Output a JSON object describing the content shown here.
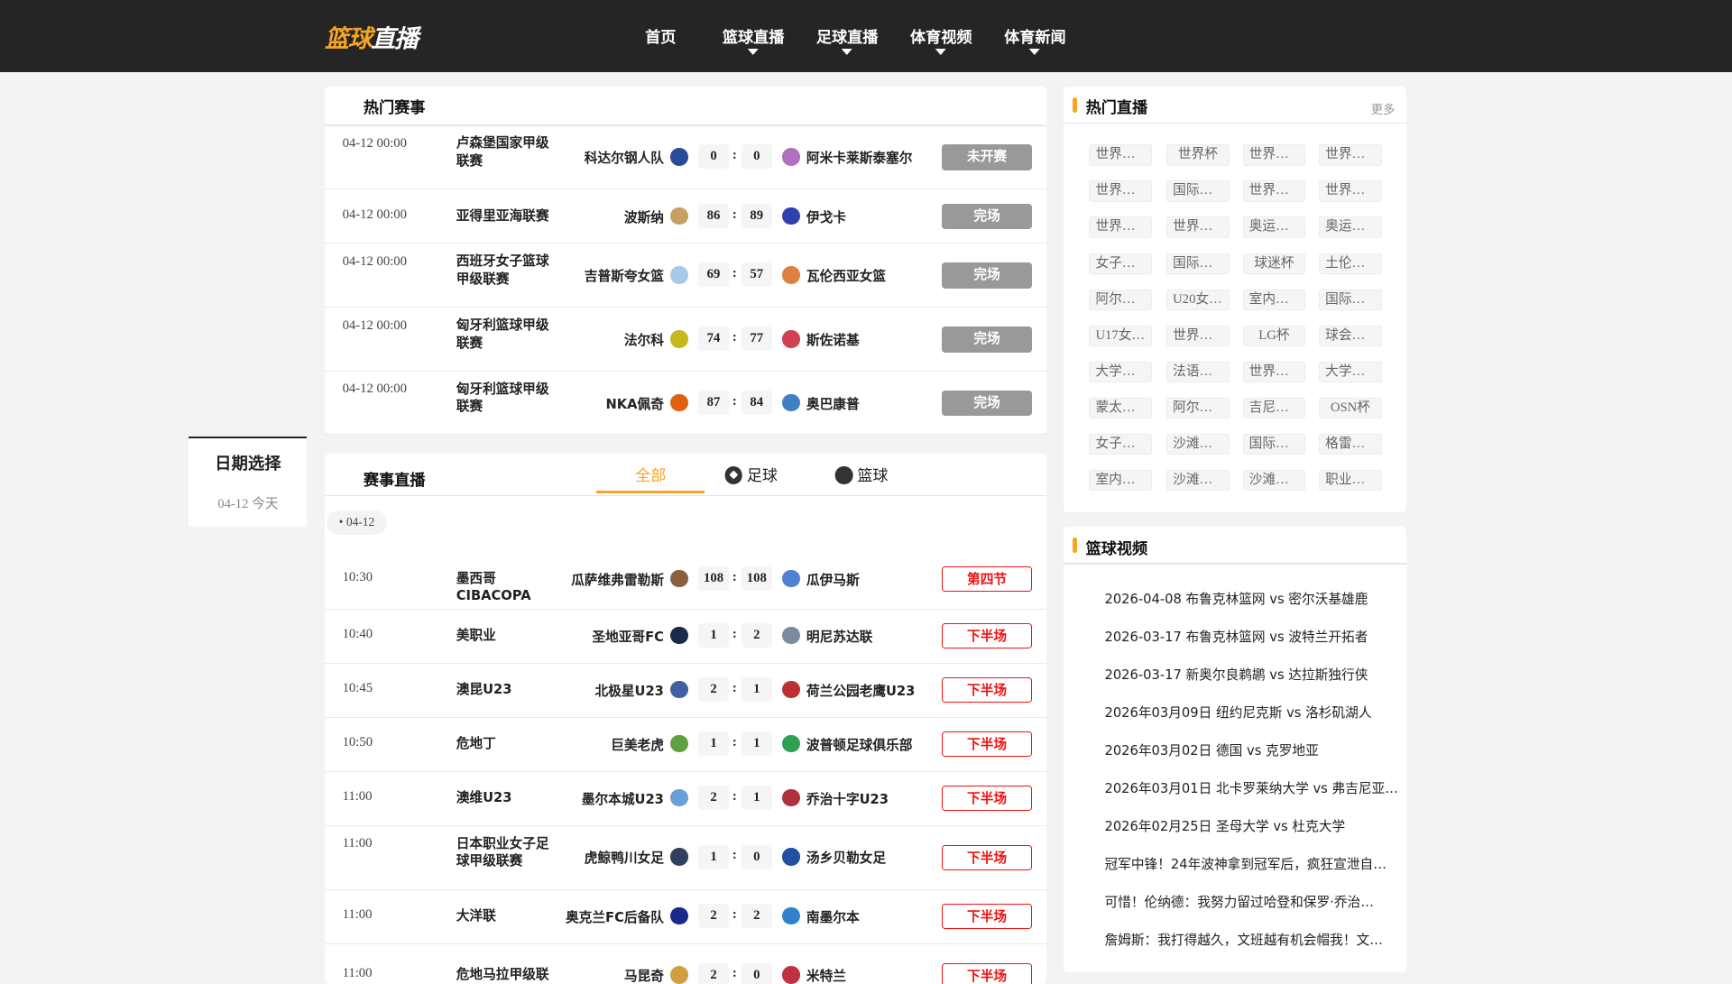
{
  "header": {
    "logo_part1": "篮球",
    "logo_part2": "直播",
    "nav": [
      {
        "label": "首页",
        "dropdown": false
      },
      {
        "label": "篮球直播",
        "dropdown": true
      },
      {
        "label": "足球直播",
        "dropdown": true
      },
      {
        "label": "体育视频",
        "dropdown": true
      },
      {
        "label": "体育新闻",
        "dropdown": true
      }
    ]
  },
  "date_picker": {
    "title": "日期选择",
    "value": "04-12 今天"
  },
  "hot_matches": {
    "title": "热门赛事",
    "rows": [
      {
        "time": "04-12 00:00",
        "league": "卢森堡国家甲级联赛",
        "home": "科达尔钢人队",
        "home_color": "#2a4a9a",
        "hs": "0",
        "as": "0",
        "away": "阿米卡莱斯泰塞尔",
        "away_color": "#b070c0",
        "status": "未开赛"
      },
      {
        "time": "04-12 00:00",
        "league": "亚得里亚海联赛",
        "home": "波斯纳",
        "home_color": "#c8a060",
        "hs": "86",
        "as": "89",
        "away": "伊戈卡",
        "away_color": "#3040b0",
        "status": "完场"
      },
      {
        "time": "04-12 00:00",
        "league": "西班牙女子篮球甲级联赛",
        "home": "吉普斯夸女篮",
        "home_color": "#a8c8e8",
        "hs": "69",
        "as": "57",
        "away": "瓦伦西亚女篮",
        "away_color": "#e08040",
        "status": "完场"
      },
      {
        "time": "04-12 00:00",
        "league": "匈牙利篮球甲级联赛",
        "home": "法尔科",
        "home_color": "#c8b820",
        "hs": "74",
        "as": "77",
        "away": "斯佐诺基",
        "away_color": "#d04050",
        "status": "完场"
      },
      {
        "time": "04-12 00:00",
        "league": "匈牙利篮球甲级联赛",
        "home": "NKA佩奇",
        "home_color": "#e06010",
        "hs": "87",
        "as": "84",
        "away": "奥巴康普",
        "away_color": "#4080c0",
        "status": "完场"
      }
    ]
  },
  "live": {
    "title": "赛事直播",
    "tabs": [
      {
        "label": "全部",
        "active": true
      },
      {
        "label": "足球",
        "icon": "soccer-ball-icon"
      },
      {
        "label": "篮球",
        "icon": "basketball-icon"
      }
    ],
    "date_chip": "04-12",
    "rows": [
      {
        "time": "10:30",
        "league": "墨西哥CIBACOPA",
        "home": "瓜萨维弗雷勒斯",
        "home_color": "#8a6040",
        "hs": "108",
        "as": "108",
        "away": "瓜伊马斯",
        "away_color": "#5080d0",
        "status": "第四节"
      },
      {
        "time": "10:40",
        "league": "美职业",
        "home": "圣地亚哥FC",
        "home_color": "#1a2a4a",
        "hs": "1",
        "as": "2",
        "away": "明尼苏达联",
        "away_color": "#7a8aa0",
        "status": "下半场"
      },
      {
        "time": "10:45",
        "league": "澳昆U23",
        "home": "北极星U23",
        "home_color": "#4060a0",
        "hs": "2",
        "as": "1",
        "away": "荷兰公园老鹰U23",
        "away_color": "#c03030",
        "status": "下半场"
      },
      {
        "time": "10:50",
        "league": "危地丁",
        "home": "巨美老虎",
        "home_color": "#60a040",
        "hs": "1",
        "as": "1",
        "away": "波普顿足球俱乐部",
        "away_color": "#30a050",
        "status": "下半场"
      },
      {
        "time": "11:00",
        "league": "澳维U23",
        "home": "墨尔本城U23",
        "home_color": "#6aa0d8",
        "hs": "2",
        "as": "1",
        "away": "乔治十字U23",
        "away_color": "#b03040",
        "status": "下半场"
      },
      {
        "time": "11:00",
        "league": "日本职业女子足球甲级联赛",
        "home": "虎鲸鸭川女足",
        "home_color": "#304060",
        "hs": "1",
        "as": "0",
        "away": "汤乡贝勒女足",
        "away_color": "#2050a0",
        "status": "下半场"
      },
      {
        "time": "11:00",
        "league": "大洋联",
        "home": "奥克兰FC后备队",
        "home_color": "#1a2a8a",
        "hs": "2",
        "as": "2",
        "away": "南墨尔本",
        "away_color": "#3080d0",
        "status": "下半场"
      },
      {
        "time": "11:00",
        "league": "危地马拉甲级联",
        "home": "马昆奇",
        "home_color": "#d0a040",
        "hs": "2",
        "as": "0",
        "away": "米特兰",
        "away_color": "#c03040",
        "status": "下半场"
      }
    ]
  },
  "hot_live": {
    "title": "热门直播",
    "more": "更多",
    "tags": [
      "世界…",
      "世界杯",
      "世界…",
      "世界…",
      "世界…",
      "国际…",
      "世界…",
      "世界…",
      "世界…",
      "世界…",
      "奥运…",
      "奥运…",
      "女子…",
      "国际…",
      "球迷杯",
      "土伦…",
      "阿尔…",
      "U20女…",
      "室内…",
      "国际…",
      "U17女…",
      "世界…",
      "LG杯",
      "球会…",
      "大学…",
      "法语…",
      "世界…",
      "大学…",
      "蒙太…",
      "阿尔…",
      "吉尼…",
      "OSN杯",
      "女子…",
      "沙滩…",
      "国际…",
      "格雷…",
      "室内…",
      "沙滩…",
      "沙滩…",
      "职业…"
    ]
  },
  "videos": {
    "title": "篮球视频",
    "items": [
      "2026-04-08 布鲁克林篮网 vs 密尔沃基雄鹿",
      "2026-03-17 布鲁克林篮网 vs 波特兰开拓者",
      "2026-03-17 新奥尔良鹈鹕 vs 达拉斯独行侠",
      "2026年03月09日 纽约尼克斯 vs 洛杉矶湖人",
      "2026年03月02日 德国 vs 克罗地亚",
      "2026年03月01日 北卡罗莱纳大学 vs 弗吉尼亚…",
      "2026年02月25日 圣母大学 vs 杜克大学",
      "冠军中锋！24年波神拿到冠军后，疯狂宣泄自…",
      "可惜！伦纳德：我努力留过哈登和保罗·乔治…",
      "詹姆斯：我打得越久，文班越有机会帽我！文…"
    ]
  },
  "colors": {
    "accent": "#f5a623",
    "header_bg": "#252525",
    "live_red": "#f01010",
    "done_gray": "#999999"
  }
}
